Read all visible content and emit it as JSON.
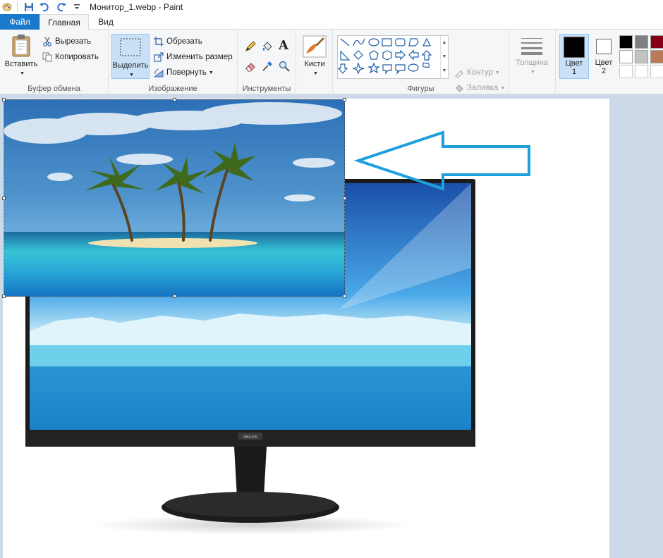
{
  "window": {
    "title": "Монитор_1.webp - Paint"
  },
  "tabs": {
    "file": "Файл",
    "home": "Главная",
    "view": "Вид"
  },
  "clipboard": {
    "paste": "Вставить",
    "cut": "Вырезать",
    "copy": "Копировать",
    "label": "Буфер обмена"
  },
  "image": {
    "select": "Выделить",
    "crop": "Обрезать",
    "resize": "Изменить размер",
    "rotate": "Повернуть",
    "label": "Изображение"
  },
  "tools": {
    "label": "Инструменты"
  },
  "brushes": {
    "label": "Кисти"
  },
  "shapes": {
    "outline": "Контур",
    "fill": "Заливка",
    "label": "Фигуры"
  },
  "size": {
    "label": "Толщина"
  },
  "colors": {
    "color1_label_top": "Цвет",
    "color1_label_bottom": "1",
    "color2_label_top": "Цвет",
    "color2_label_bottom": "2",
    "color1": "#000000",
    "color2": "#ffffff",
    "palette": [
      "#000000",
      "#7f7f7f",
      "#880015",
      "#ffffff",
      "#c3c3c3",
      "#b97a57",
      "#ffffff",
      "#ffffff",
      "#ffffff"
    ]
  },
  "monitor": {
    "brand": "PHILIPS"
  },
  "accent": "#1979ca",
  "arrow_color": "#1fa0dd"
}
